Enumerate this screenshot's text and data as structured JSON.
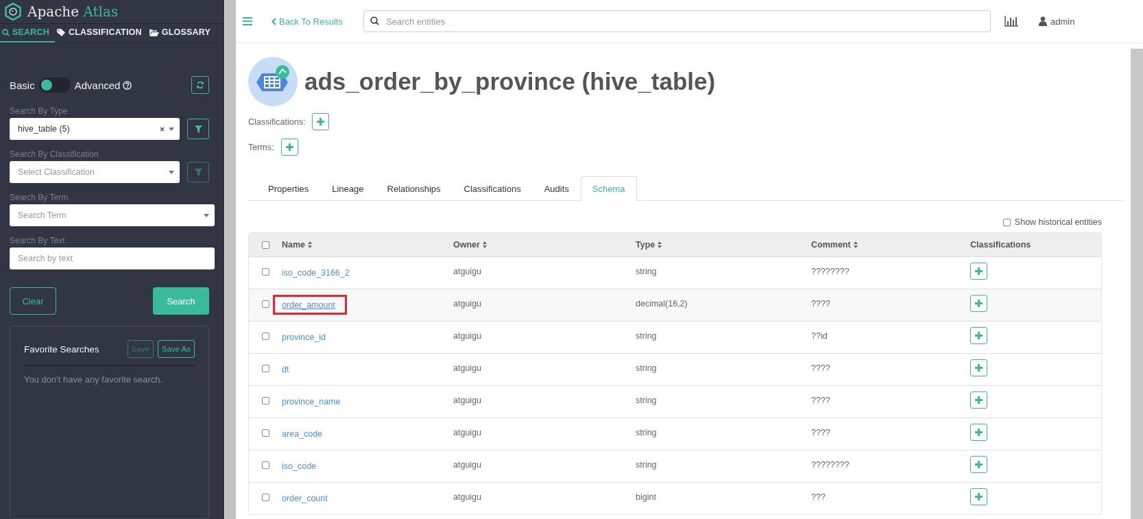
{
  "sidebar": {
    "logo": {
      "first": "Apache",
      "second": "Atlas"
    },
    "tabs": [
      {
        "label": "SEARCH",
        "selected": true
      },
      {
        "label": "CLASSIFICATION",
        "selected": false
      },
      {
        "label": "GLOSSARY",
        "selected": false
      }
    ],
    "mode": {
      "basic_label": "Basic",
      "advanced_label": "Advanced",
      "advanced": false
    },
    "filters": [
      {
        "label": "Search By Type",
        "kind": "select",
        "value": "hive_table (5)",
        "filter_button": {
          "disabled": false
        }
      },
      {
        "label": "Search By Classification",
        "kind": "select",
        "placeholder": "Select Classification",
        "filter_button": {
          "disabled": true
        }
      },
      {
        "label": "Search By Term",
        "kind": "select",
        "placeholder": "Search Term"
      },
      {
        "label": "Search By Text",
        "kind": "text",
        "placeholder": "Search by text"
      }
    ],
    "clear_button": "Clear",
    "search_button": "Search",
    "favorites": {
      "title": "Favorite Searches",
      "buttons": [
        {
          "label": "Save",
          "disabled": true
        },
        {
          "label": "Save As",
          "disabled": false
        }
      ],
      "empty_message": "You don't have any favorite search."
    }
  },
  "header": {
    "back_link": "Back To Results",
    "search_placeholder": "Search entities",
    "user": "admin"
  },
  "entity": {
    "title": "ads_order_by_province (hive_table)",
    "sections": [
      {
        "label": "Classifications:"
      },
      {
        "label": "Terms:"
      }
    ],
    "tabs": [
      {
        "label": "Properties",
        "selected": false
      },
      {
        "label": "Lineage",
        "selected": false
      },
      {
        "label": "Relationships",
        "selected": false
      },
      {
        "label": "Classifications",
        "selected": false
      },
      {
        "label": "Audits",
        "selected": false
      },
      {
        "label": "Schema",
        "selected": true
      }
    ],
    "show_historical": {
      "label": "Show historical entities",
      "checked": false
    },
    "table": {
      "select_all": {
        "checked": false
      },
      "columns": [
        {
          "label": "Name",
          "sortable": true
        },
        {
          "label": "Owner",
          "sortable": true
        },
        {
          "label": "Type",
          "sortable": true
        },
        {
          "label": "Comment",
          "sortable": true
        },
        {
          "label": "Classifications",
          "sortable": false
        }
      ],
      "rows": [
        {
          "name": "iso_code_3166_2",
          "owner": "atguigu",
          "type": "string",
          "comment": "????????",
          "checked": false,
          "highlighted": false
        },
        {
          "name": "order_amount",
          "owner": "atguigu",
          "type": "decimal(16,2)",
          "comment": "????",
          "checked": false,
          "highlighted": true
        },
        {
          "name": "province_id",
          "owner": "atguigu",
          "type": "string",
          "comment": "??id",
          "checked": false,
          "highlighted": false
        },
        {
          "name": "dt",
          "owner": "atguigu",
          "type": "string",
          "comment": "????",
          "checked": false,
          "highlighted": false
        },
        {
          "name": "province_name",
          "owner": "atguigu",
          "type": "string",
          "comment": "????",
          "checked": false,
          "highlighted": false
        },
        {
          "name": "area_code",
          "owner": "atguigu",
          "type": "string",
          "comment": "????",
          "checked": false,
          "highlighted": false
        },
        {
          "name": "iso_code",
          "owner": "atguigu",
          "type": "string",
          "comment": "????????",
          "checked": false,
          "highlighted": false
        },
        {
          "name": "order_count",
          "owner": "atguigu",
          "type": "bigint",
          "comment": "???",
          "checked": false,
          "highlighted": false
        }
      ]
    }
  }
}
